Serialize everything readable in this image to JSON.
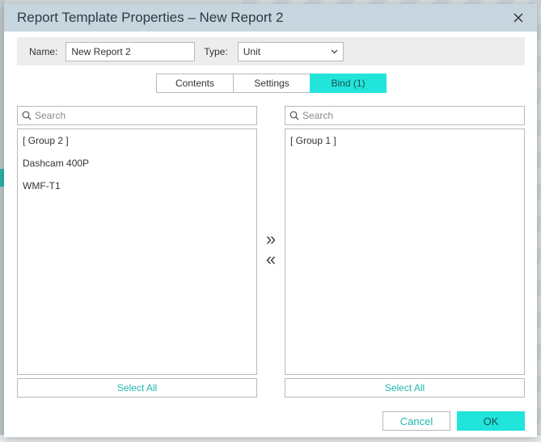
{
  "dialog": {
    "title": "Report Template Properties – New Report 2",
    "close_icon": "close-icon"
  },
  "properties": {
    "name_label": "Name:",
    "name_value": "New Report 2",
    "type_label": "Type:",
    "type_value": "Unit"
  },
  "tabs": [
    {
      "label": "Contents"
    },
    {
      "label": "Settings"
    },
    {
      "label": "Bind (1)",
      "active": true
    }
  ],
  "left_panel": {
    "search_placeholder": "Search",
    "items": [
      "[ Group 2 ]",
      "Dashcam 400P",
      "WMF-T1"
    ],
    "select_all": "Select All"
  },
  "right_panel": {
    "search_placeholder": "Search",
    "items": [
      "[ Group 1 ]"
    ],
    "select_all": "Select All"
  },
  "transfer": {
    "add": "»",
    "remove": "«"
  },
  "footer": {
    "cancel": "Cancel",
    "ok": "OK"
  },
  "colors": {
    "accent": "#21e5db",
    "accent_text": "#21b8b0",
    "titlebar": "#c7d6de"
  }
}
